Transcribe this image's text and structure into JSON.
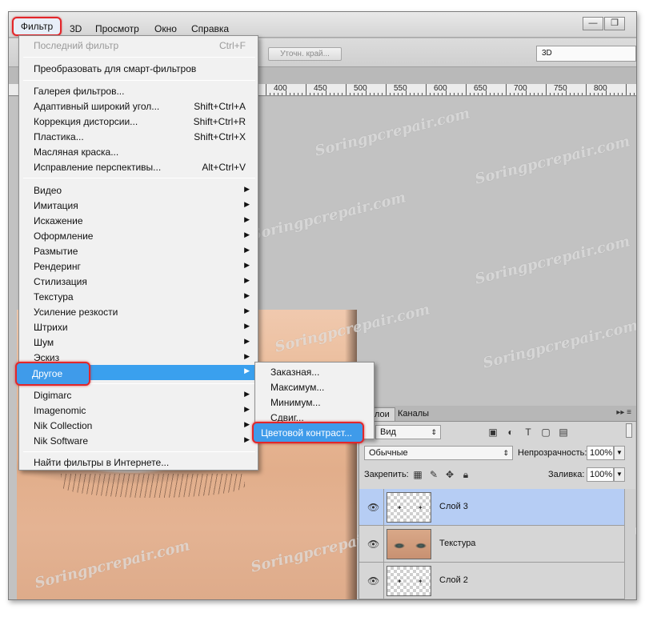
{
  "menubar": {
    "filter": "Фильтр",
    "items": [
      "3D",
      "Просмотр",
      "Окно",
      "Справка"
    ]
  },
  "options_bar": {
    "refine_edge": "Уточн. край...",
    "workspace": "3D"
  },
  "ruler": {
    "numbers": [
      "400",
      "450",
      "500",
      "550",
      "600",
      "650",
      "700",
      "750",
      "800"
    ]
  },
  "filter_menu": {
    "last_filter": {
      "label": "Последний фильтр",
      "shortcut": "Ctrl+F"
    },
    "smart_filters": "Преобразовать для смарт-фильтров",
    "gallery": [
      {
        "label": "Галерея фильтров...",
        "shortcut": ""
      },
      {
        "label": "Адаптивный широкий угол...",
        "shortcut": "Shift+Ctrl+A"
      },
      {
        "label": "Коррекция дисторсии...",
        "shortcut": "Shift+Ctrl+R"
      },
      {
        "label": "Пластика...",
        "shortcut": "Shift+Ctrl+X"
      },
      {
        "label": "Масляная краска...",
        "shortcut": ""
      },
      {
        "label": "Исправление перспективы...",
        "shortcut": "Alt+Ctrl+V"
      }
    ],
    "groups": [
      "Видео",
      "Имитация",
      "Искажение",
      "Оформление",
      "Размытие",
      "Рендеринг",
      "Стилизация",
      "Текстура",
      "Усиление резкости",
      "Штрихи",
      "Шум",
      "Эскиз"
    ],
    "other": "Другое",
    "plugins": [
      "Digimarc",
      "Imagenomic",
      "Nik Collection",
      "Nik Software"
    ],
    "find_online": "Найти фильтры в Интернете..."
  },
  "submenu": {
    "items": [
      "Заказная...",
      "Максимум...",
      "Минимум...",
      "Сдвиг..."
    ],
    "highlighted": "Цветовой контраст..."
  },
  "layers_panel": {
    "tabs": [
      "Слои",
      "Каналы"
    ],
    "kind_filter": "Вид",
    "blend_mode": "Обычные",
    "opacity_label": "Непрозрачность:",
    "opacity_value": "100%",
    "lock_label": "Закрепить:",
    "fill_label": "Заливка:",
    "fill_value": "100%",
    "layers": [
      {
        "name": "Слой 3",
        "selected": true
      },
      {
        "name": "Текстура",
        "selected": false
      },
      {
        "name": "Слой 2",
        "selected": false
      }
    ]
  },
  "watermark": "Soringpcrepair.com",
  "colors": {
    "highlight_blue": "#3f9bea",
    "annotation_red": "#e3262a",
    "selected_layer": "#b6cdf4"
  }
}
